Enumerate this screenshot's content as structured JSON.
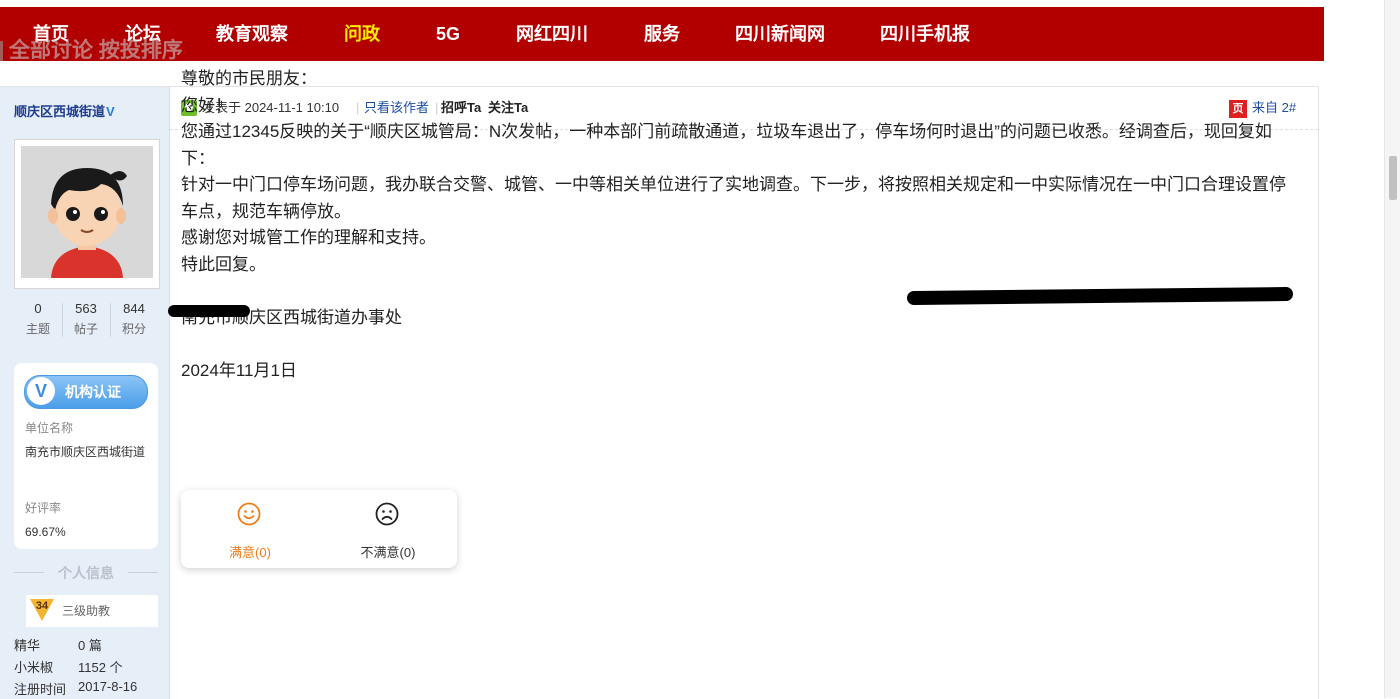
{
  "nav": {
    "items": [
      "首页",
      "论坛",
      "教育观察",
      "问政",
      "5G",
      "网红四川",
      "服务",
      "四川新闻网",
      "四川手机报"
    ],
    "active_index": 3,
    "background_color": "#b20000",
    "active_color": "#ffea00"
  },
  "ghost_title": "全部讨论 按投排序",
  "author": {
    "name": "顺庆区西城街道",
    "verified_mark": "V",
    "stats": [
      {
        "value": "0",
        "label": "主题"
      },
      {
        "value": "563",
        "label": "帖子"
      },
      {
        "value": "844",
        "label": "积分"
      }
    ],
    "cert": {
      "badge_icon": "V",
      "badge_text": "机构认证",
      "unit_label": "单位名称",
      "unit_value": "南充市顺庆区西城街道",
      "rating_label": "好评率",
      "rating_value": "69.67%"
    },
    "personal_header": "个人信息",
    "level": {
      "number": "34",
      "title": "三级助教"
    },
    "info": [
      {
        "label": "精华",
        "value": "0 篇"
      },
      {
        "label": "小米椒",
        "value": "1152 个"
      },
      {
        "label": "注册时间",
        "value": "2017-8-16"
      }
    ]
  },
  "post_header": {
    "posted_at": "发表于 2024-11-1 10:10",
    "only_author": "只看该作者",
    "greet": "招呼Ta",
    "follow": "关注Ta",
    "from_icon": "页",
    "from_text": "来自 2#"
  },
  "post_body": {
    "lines": [
      "尊敬的市民朋友：",
      "您好！",
      "您通过12345反映的关于“顺庆区城管局：N次发帖，一种本部门前疏散通道，垃圾车退出了，停车场何时退出”的问题已收悉。经调查后，现回复如下：",
      "针对一中门口停车场问题，我办联合交警、城管、一中等相关单位进行了实地调查。下一步，将按照相关规定和一中实际情况在一中门口合理设置停车点，规范车辆停放。",
      "感谢您对城管工作的理解和支持。",
      "特此回复。",
      "",
      "南充市顺庆区西城街道办事处",
      "",
      "2024年11月1日"
    ]
  },
  "vote": {
    "satisfied": "满意(0)",
    "unsatisfied": "不满意(0)",
    "satisfied_color": "#f07d1c",
    "unsatisfied_color": "#333333"
  }
}
